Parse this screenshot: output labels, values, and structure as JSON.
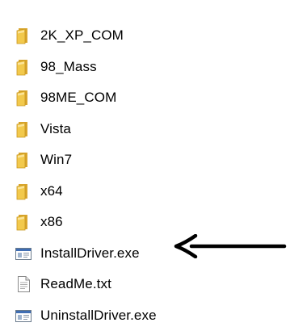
{
  "file_list": {
    "items": [
      {
        "name": "2K_XP_COM",
        "type": "folder",
        "icon": "folder-icon"
      },
      {
        "name": "98_Mass",
        "type": "folder",
        "icon": "folder-icon"
      },
      {
        "name": "98ME_COM",
        "type": "folder",
        "icon": "folder-icon"
      },
      {
        "name": "Vista",
        "type": "folder",
        "icon": "folder-icon"
      },
      {
        "name": "Win7",
        "type": "folder",
        "icon": "folder-icon"
      },
      {
        "name": "x64",
        "type": "folder",
        "icon": "folder-icon"
      },
      {
        "name": "x86",
        "type": "folder",
        "icon": "folder-icon"
      },
      {
        "name": "InstallDriver.exe",
        "type": "application",
        "icon": "executable-icon"
      },
      {
        "name": "ReadMe.txt",
        "type": "text",
        "icon": "text-file-icon"
      },
      {
        "name": "UninstallDriver.exe",
        "type": "application",
        "icon": "executable-icon"
      }
    ]
  },
  "annotation": {
    "icon": "arrow-left-icon",
    "color": "#000000"
  },
  "colors": {
    "folder_front": "#f2c94c",
    "folder_back": "#d9a62e",
    "text": "#000000"
  }
}
